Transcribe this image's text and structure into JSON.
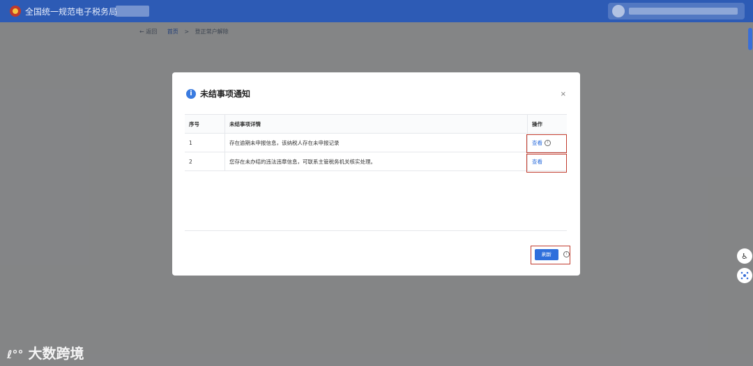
{
  "header": {
    "app_title": "全国统一规范电子税务局"
  },
  "breadcrumb": {
    "back": "返回",
    "home": "首页",
    "separator": ">",
    "current": "登正常户解除"
  },
  "modal": {
    "title": "未结事项通知",
    "close_label": "×",
    "columns": [
      "序号",
      "未结事项详情",
      "操作"
    ],
    "rows": [
      {
        "index": "1",
        "detail": "存在逾期未申报信息，该纳税人存在未申报记录",
        "action": "查看"
      },
      {
        "index": "2",
        "detail": "您存在未办结的违法违章信息，可联系主管税务机关核实处理。",
        "action": "查看"
      }
    ],
    "refresh_label": "刷新"
  },
  "watermark": {
    "text": "大数跨境"
  },
  "icons": {
    "info": "info-icon",
    "close": "close-icon",
    "accessibility": "accessibility-icon",
    "assistant": "assistant-icon"
  },
  "colors": {
    "header_bg": "#2d5bb5",
    "primary": "#2f6fdc",
    "highlight_border": "#c0392b"
  }
}
